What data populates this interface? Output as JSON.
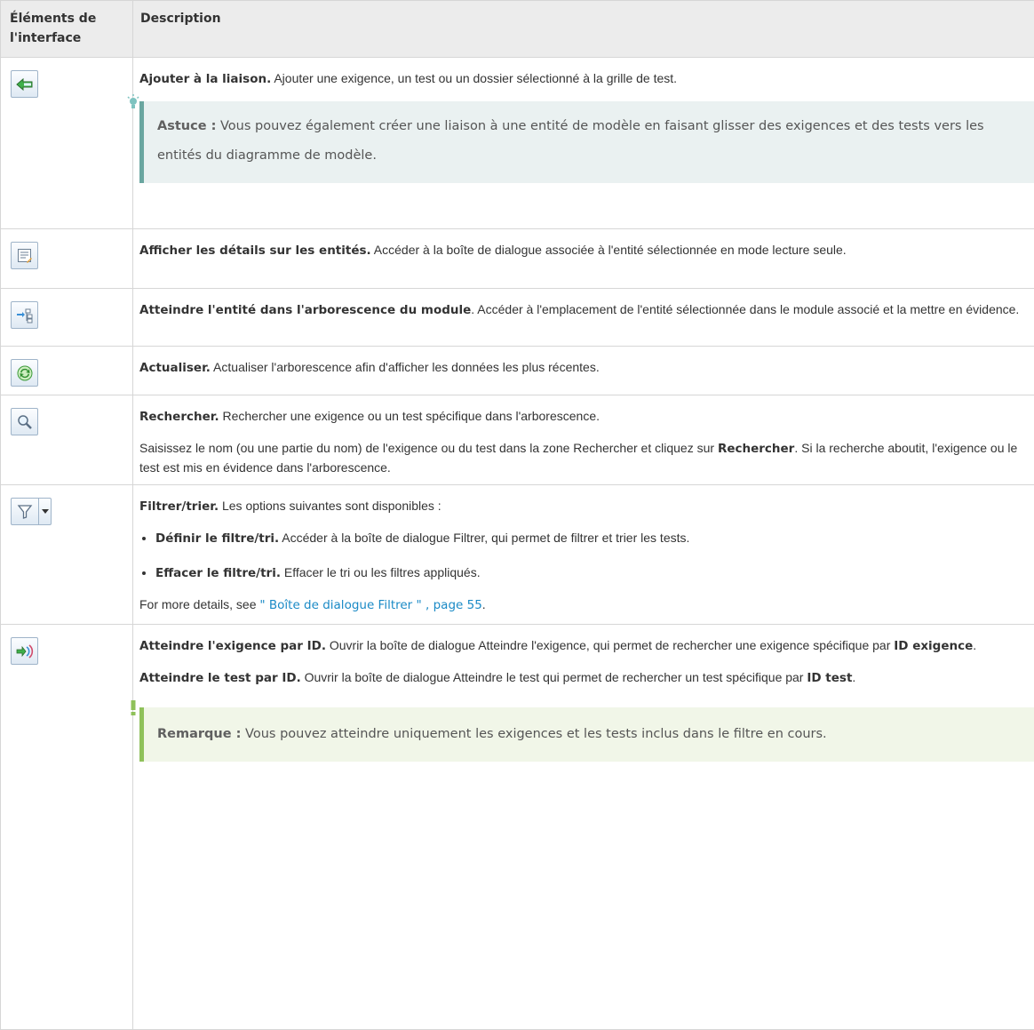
{
  "header": {
    "col1": "Éléments de l'interface",
    "col2": "Description"
  },
  "rows": [
    {
      "icon": "add-to-link-arrow-icon",
      "title": "Ajouter à la liaison.",
      "text": " Ajouter une exigence, un test ou un dossier sélectionné à la grille de test.",
      "tip": {
        "label": "Astuce :",
        "text": " Vous pouvez également créer une liaison à une entité de modèle en faisant glisser des exigences et des tests vers les entités du diagramme de modèle."
      }
    },
    {
      "icon": "entity-details-icon",
      "title": "Afficher les détails sur les entités.",
      "text": " Accéder à la boîte de dialogue associée à l'entité sélectionnée en mode lecture seule."
    },
    {
      "icon": "go-to-entity-tree-icon",
      "title": "Atteindre l'entité dans l'arborescence du module",
      "text": ". Accéder à l'emplacement de l'entité sélectionnée dans le module associé et la mettre en évidence."
    },
    {
      "icon": "refresh-icon",
      "title": "Actualiser.",
      "text": " Actualiser l'arborescence afin d'afficher les données les plus récentes."
    },
    {
      "icon": "search-icon",
      "title": "Rechercher.",
      "text": " Rechercher une exigence ou un test spécifique dans l'arborescence.",
      "text2_a": "Saisissez le nom (ou une partie du nom) de l'exigence ou du test dans la zone Rechercher et cliquez sur ",
      "text2_b": "Rechercher",
      "text2_c": ". Si la recherche aboutit, l'exigence ou le test est mis en évidence dans l'arborescence."
    },
    {
      "icon": "filter-icon",
      "title": "Filtrer/trier.",
      "text": " Les options suivantes sont disponibles :",
      "options": [
        {
          "title": "Définir le filtre/tri.",
          "text": " Accéder à la boîte de dialogue Filtrer, qui permet de filtrer et trier les tests."
        },
        {
          "title": "Effacer le filtre/tri.",
          "text": " Effacer le tri ou les filtres appliqués."
        }
      ],
      "more_prefix": "For more details, see ",
      "more_link": "\" Boîte de dialogue Filtrer \" , page 55",
      "more_suffix": "."
    },
    {
      "icon": "go-to-by-id-icon",
      "title": "Atteindre l'exigence par ID.",
      "text": " Ouvrir la boîte de dialogue Atteindre l'exigence, qui permet de rechercher une exigence spécifique par ",
      "text_bold": "ID exigence",
      "text_end": ".",
      "title2": "Atteindre le test par ID.",
      "text2": " Ouvrir la boîte de dialogue Atteindre le test qui permet de rechercher un test spécifique par ",
      "text2_bold": "ID test",
      "text2_end": ".",
      "note": {
        "label": "Remarque :",
        "text": " Vous pouvez atteindre uniquement les exigences et les tests inclus dans le filtre en cours."
      }
    }
  ]
}
